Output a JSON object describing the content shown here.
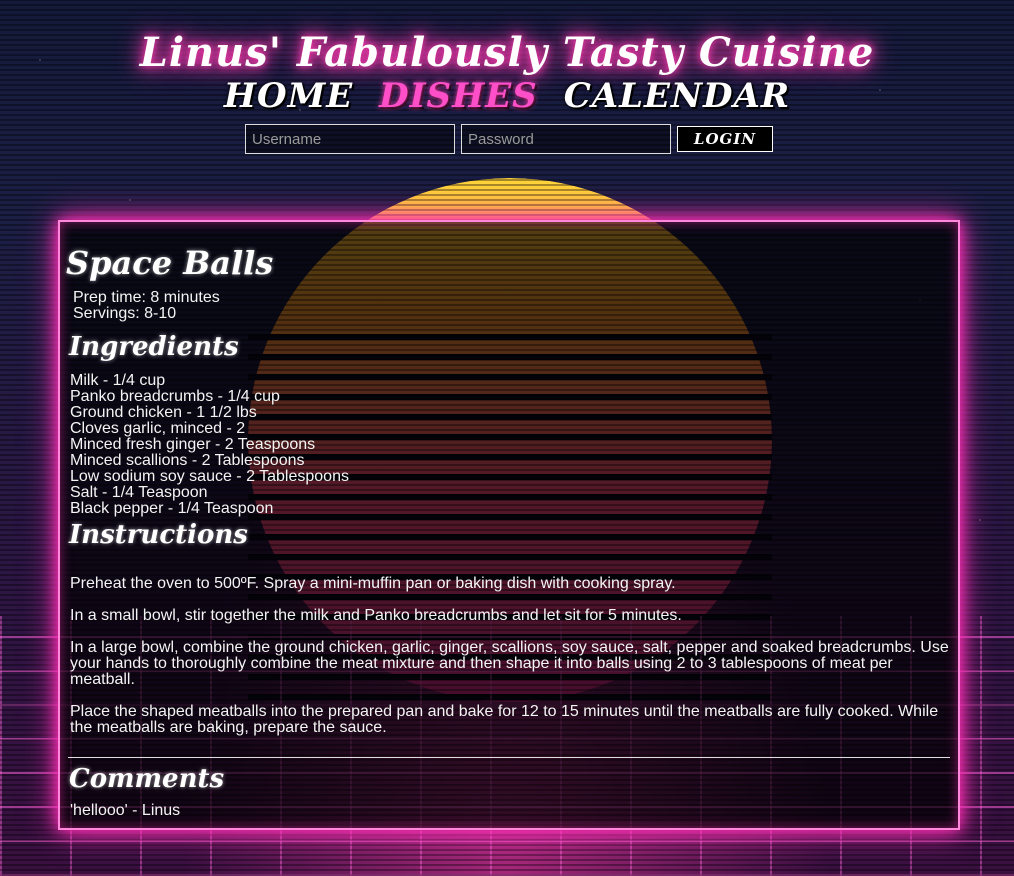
{
  "site_title": "Linus' Fabulously Tasty Cuisine",
  "nav": [
    "Home",
    "Dishes",
    "Calendar"
  ],
  "login": {
    "username_placeholder": "Username",
    "password_placeholder": "Password",
    "button_label": "Login"
  },
  "dish": {
    "name": "Space Balls",
    "prep_time": "Prep time: 8 minutes",
    "servings": "Servings: 8-10",
    "ingredients_heading": "Ingredients",
    "ingredients": [
      "Milk - 1/4 cup",
      "Panko breadcrumbs - 1/4 cup",
      "Ground chicken - 1 1/2 lbs",
      "Cloves garlic, minced - 2",
      "Minced fresh ginger - 2 Teaspoons",
      "Minced scallions - 2 Tablespoons",
      "Low sodium soy sauce - 2 Tablespoons",
      "Salt - 1/4 Teaspoon",
      "Black pepper - 1/4 Teaspoon"
    ],
    "instructions_heading": "Instructions",
    "instructions": [
      "Preheat the oven to 500ºF. Spray a mini-muffin pan or baking dish with cooking spray.",
      "In a small bowl, stir together the milk and Panko breadcrumbs and let sit for 5 minutes.",
      "In a large bowl, combine the ground chicken, garlic, ginger, scallions, soy sauce, salt, pepper and soaked breadcrumbs. Use your hands to thoroughly combine the meat mixture and then shape it into balls using 2 to 3 tablespoons of meat per meatball.",
      "Place the shaped meatballs into the prepared pan and bake for 12 to 15 minutes until the meatballs are fully cooked. While the meatballs are baking, prepare the sauce."
    ],
    "comments_heading": "Comments",
    "comments": [
      "'hellooo' - Linus"
    ]
  },
  "colors": {
    "neon_pink": "#ff2fb6",
    "active_nav": "#ff4fc8",
    "text": "#f4f4f4"
  }
}
